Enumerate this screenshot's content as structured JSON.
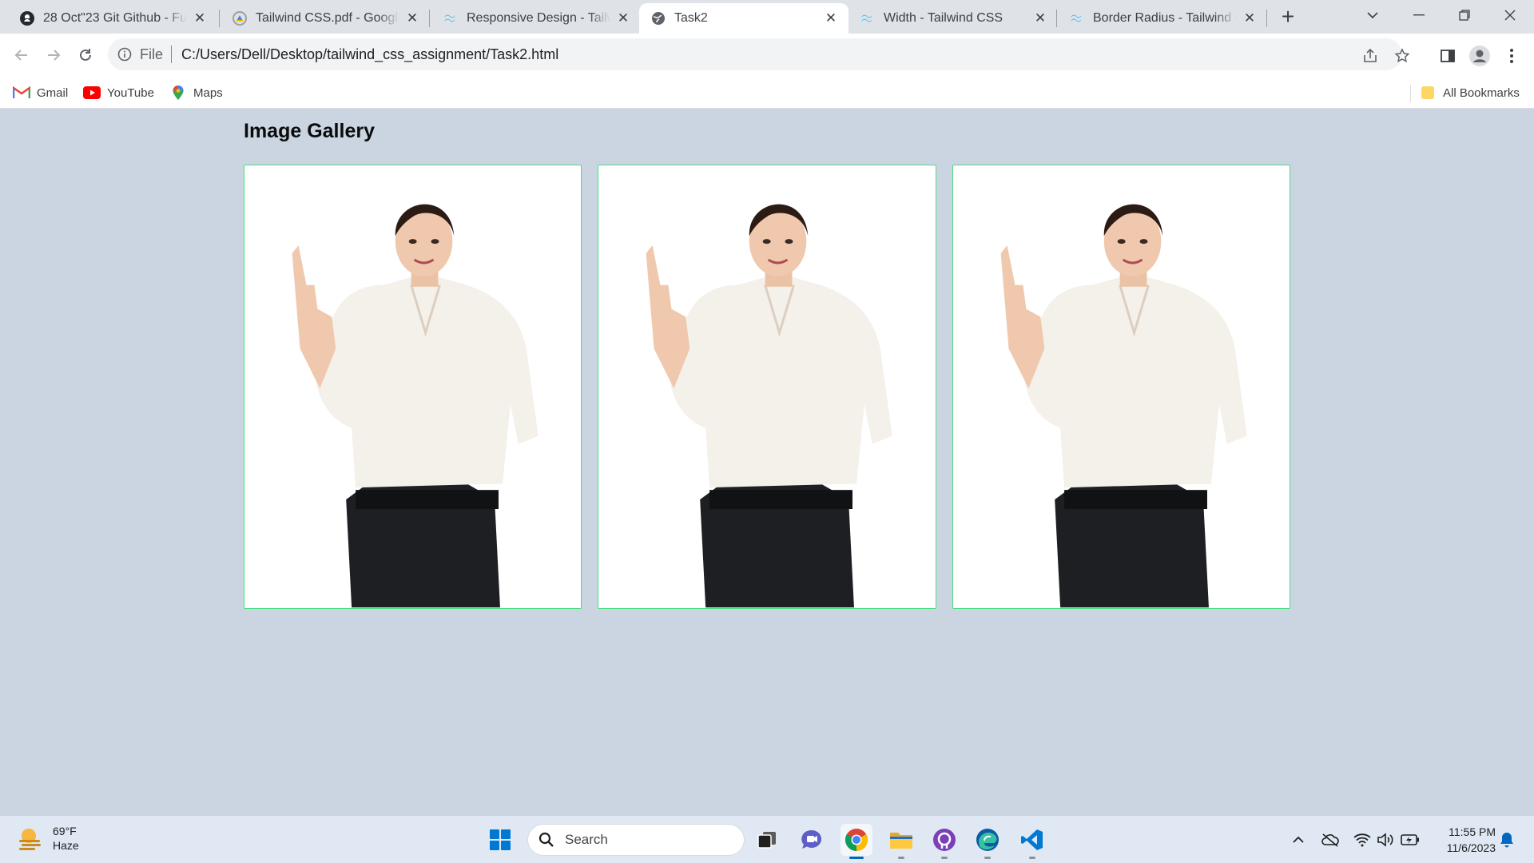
{
  "browser": {
    "tabs": [
      {
        "title": "28 Oct\"23 Git Github - Full",
        "icon": "github-icon",
        "active": false
      },
      {
        "title": "Tailwind CSS.pdf - Google D",
        "icon": "google-drive-icon",
        "active": false
      },
      {
        "title": "Responsive Design - Tailwin",
        "icon": "tailwind-icon",
        "active": false
      },
      {
        "title": "Task2",
        "icon": "globe-icon",
        "active": true
      },
      {
        "title": "Width - Tailwind CSS",
        "icon": "tailwind-icon",
        "active": false
      },
      {
        "title": "Border Radius - Tailwind C",
        "icon": "tailwind-icon",
        "active": false
      }
    ],
    "address": {
      "scheme": "File",
      "url": "C:/Users/Dell/Desktop/tailwind_css_assignment/Task2.html"
    },
    "bookmarks": [
      {
        "label": "Gmail",
        "icon": "gmail-icon"
      },
      {
        "label": "YouTube",
        "icon": "youtube-icon"
      },
      {
        "label": "Maps",
        "icon": "maps-icon"
      }
    ],
    "all_bookmarks_label": "All Bookmarks"
  },
  "page": {
    "title": "Image Gallery",
    "images": [
      {
        "subject": "woman-pointing-up"
      },
      {
        "subject": "woman-pointing-up"
      },
      {
        "subject": "woman-pointing-up"
      }
    ]
  },
  "taskbar": {
    "weather": {
      "temp": "69°F",
      "condition": "Haze"
    },
    "search_label": "Search",
    "clock": {
      "time": "11:55 PM",
      "date": "11/6/2023"
    }
  },
  "colors": {
    "page_bg": "#cbd5e1",
    "card_border": "#4ade80",
    "taskbar_bg": "#dfe8f3",
    "accent": "#0067c0"
  }
}
